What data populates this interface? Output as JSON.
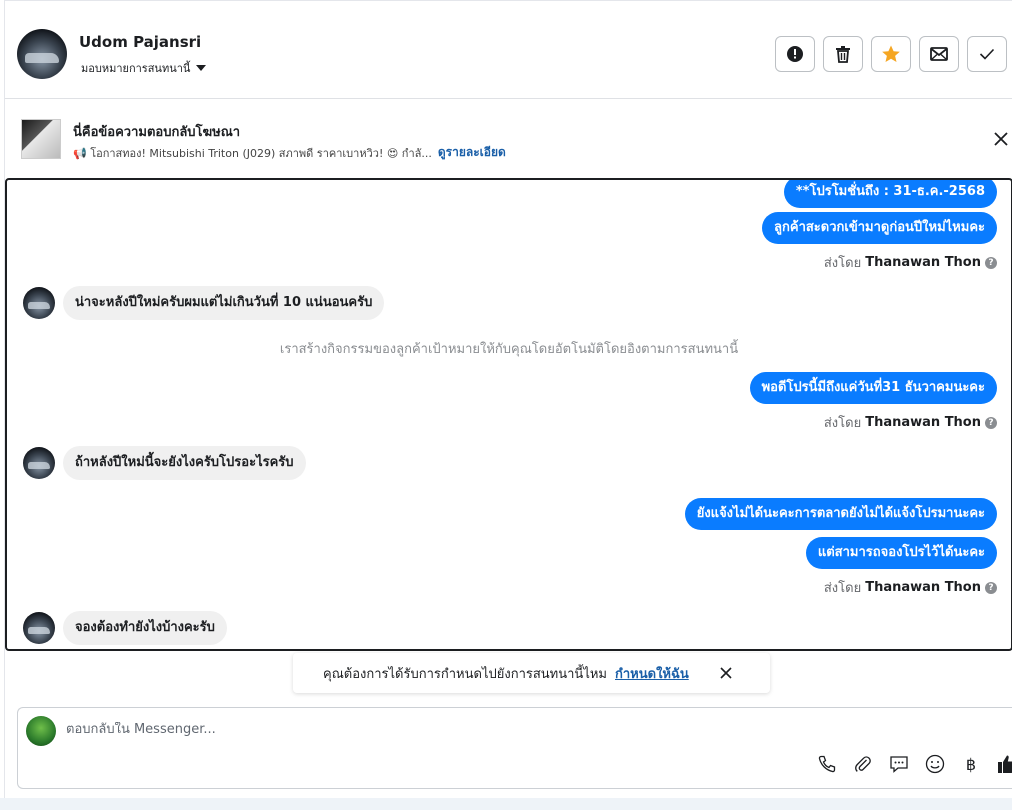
{
  "header": {
    "contact_name": "Udom Pajansri",
    "assign_label": "มอบหมายการสนทนานี้",
    "actions": [
      {
        "name": "spam-button",
        "icon": "alert-circle-icon"
      },
      {
        "name": "delete-button",
        "icon": "trash-icon"
      },
      {
        "name": "star-button",
        "icon": "star-icon"
      },
      {
        "name": "mark-unread-button",
        "icon": "envelope-icon"
      },
      {
        "name": "mark-done-button",
        "icon": "check-icon"
      }
    ],
    "star_color": "#f5a623"
  },
  "ad_reply": {
    "title": "นี่คือข้อความตอบกลับโฆษณา",
    "snippet": "📢 โอกาสทอง! Mitsubishi Triton (J029) สภาพดี ราคาเบาหวิว! 😍 กำลั...",
    "link": "ดูรายละเอียด"
  },
  "messages": {
    "out_1": "**โปรโมชั่นถึง : 31-ธ.ค.-2568",
    "out_2": "ลูกค้าสะดวกเข้ามาดูก่อนปีใหม่ไหมคะ",
    "sent_by_prefix": "ส่งโดย",
    "sender": "Thanawan Thon",
    "in_1": "น่าจะหลังปีใหม่ครับผมแต่ไม่เกินวันที่ 10 แน่นอนครับ",
    "system": "เราสร้างกิจกรรมของลูกค้าเป้าหมายให้กับคุณโดยอัตโนมัติโดยอิงตามการสนทนานี้",
    "out_3": "พอดีโปรนี้มีถึงแค่วันที่31 ธันวาคมนะคะ",
    "in_2": "ถ้าหลังปีใหม่นี้จะยังไงครับโปรอะไรครับ",
    "out_4": "ยังแจ้งไม่ได้นะคะการตลาดยังไม่ได้แจ้งโปรมานะคะ",
    "out_5": "แต่สามารถจองโปรไว้ได้นะคะ",
    "in_3": "จองต้องทำยังไงบ้างคะรับ"
  },
  "toast": {
    "text": "คุณต้องการได้รับการกำหนดไปยังการสนทนานี้ไหม",
    "link": "กำหนดให้ฉัน"
  },
  "composer": {
    "placeholder": "ตอบกลับใน Messenger...",
    "tools": [
      "phone-icon",
      "paperclip-icon",
      "saved-reply-icon",
      "emoji-icon",
      "baht-icon",
      "thumbs-up-icon"
    ],
    "baht_symbol": "฿"
  },
  "colors": {
    "outgoing_bubble": "#0a7cff",
    "incoming_bubble": "#f0f0f0",
    "link": "#1a5fa8"
  }
}
